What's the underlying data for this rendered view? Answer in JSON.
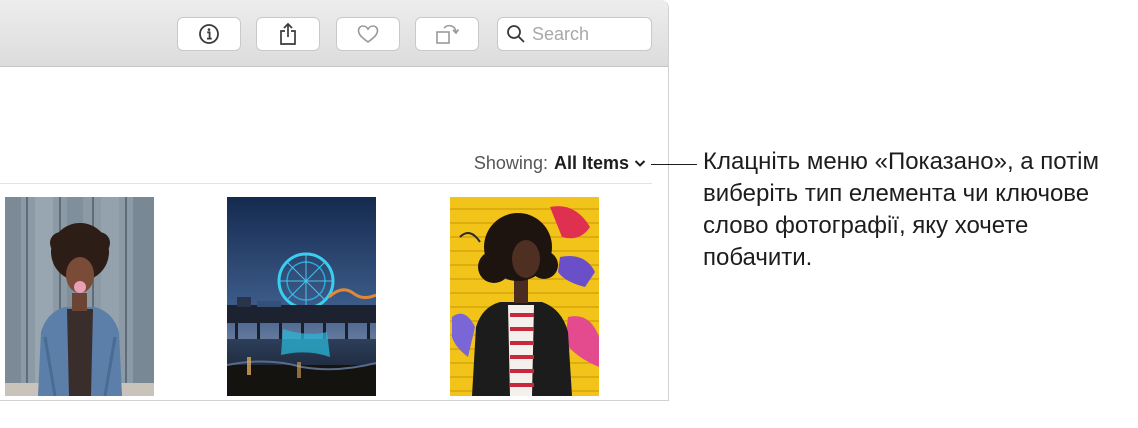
{
  "toolbar": {
    "buttons": [
      {
        "name": "info",
        "icon": "info-icon"
      },
      {
        "name": "share",
        "icon": "share-icon"
      },
      {
        "name": "favorite",
        "icon": "heart-icon"
      },
      {
        "name": "rotate",
        "icon": "rotate-icon"
      }
    ],
    "search": {
      "placeholder": "Search",
      "value": "",
      "icon": "search-icon"
    }
  },
  "filter": {
    "label": "Showing:",
    "value": "All Items",
    "icon": "chevron-down-icon"
  },
  "photos": [
    {
      "subject": "woman blowing bubble gum, denim jacket, grey wooden wall"
    },
    {
      "subject": "illuminated ferris wheel on a pier at dusk"
    },
    {
      "subject": "woman in leather jacket and striped top, yellow graffiti wall"
    }
  ],
  "callout": {
    "text": "Клацніть меню «Показано», а потім виберіть тип елемента чи ключове слово фотографії, яку хочете побачити."
  },
  "colors": {
    "toolbar": "#e4e4e4",
    "text": "#1d1d1f",
    "muted": "#555555"
  }
}
